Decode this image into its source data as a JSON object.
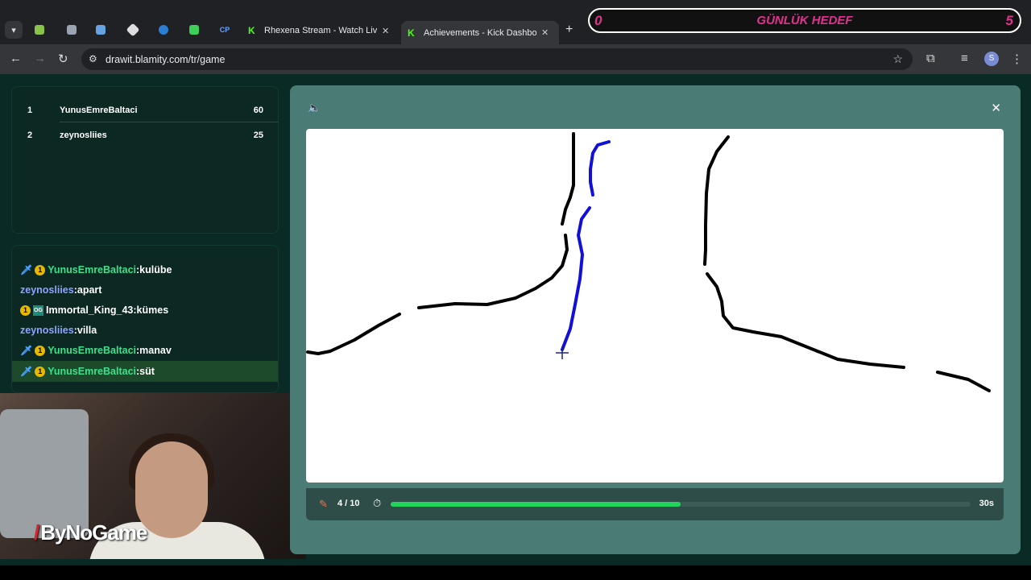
{
  "browser": {
    "tabs": [
      {
        "title": "Rhexena Stream - Watch Live o",
        "icon": "kick-icon"
      },
      {
        "title": "Achievements - Kick Dashboard",
        "icon": "kick-icon"
      }
    ],
    "cp_label": "CP",
    "url": "drawit.blamity.com/tr/game",
    "profile_initial": "S"
  },
  "goal_overlay": {
    "current": "0",
    "label": "GÜNLÜK HEDEF",
    "target": "5",
    "color": "#e0338f"
  },
  "leaderboard": [
    {
      "rank": "1",
      "name": "YunusEmreBaltaci",
      "score": "60"
    },
    {
      "rank": "2",
      "name": "zeynosliies",
      "score": "25"
    }
  ],
  "chat": [
    {
      "user": "YunusEmreBaltaci",
      "text": ":kulübe",
      "badges": [
        "sword",
        "gold"
      ],
      "color": "green"
    },
    {
      "user": "zeynosliies",
      "text": ":apart",
      "badges": [],
      "color": "blue"
    },
    {
      "user": "Immortal_King_43",
      "text": ":kümes",
      "badges": [
        "gold",
        "og"
      ],
      "color": "white"
    },
    {
      "user": "zeynosliies",
      "text": ":villa",
      "badges": [],
      "color": "blue"
    },
    {
      "user": "YunusEmreBaltaci",
      "text": ":manav",
      "badges": [
        "sword",
        "gold"
      ],
      "color": "green"
    },
    {
      "user": "YunusEmreBaltaci",
      "text": ":süt",
      "badges": [
        "sword",
        "gold"
      ],
      "color": "green",
      "highlighted": true
    }
  ],
  "webcam": {
    "brand": "ByNoGame"
  },
  "game": {
    "round": "4 / 10",
    "time_left": "30s",
    "progress_fraction": 0.5,
    "progress_color": "#22d35b"
  }
}
